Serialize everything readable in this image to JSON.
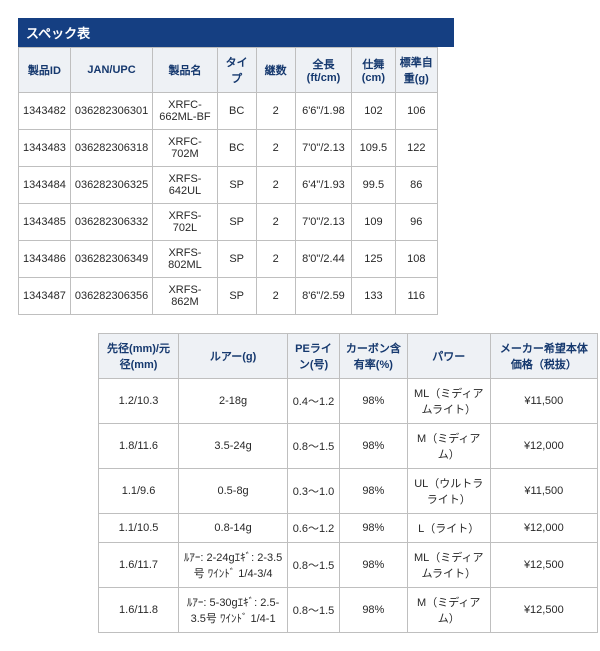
{
  "title": "スペック表",
  "table1": {
    "headers": [
      "製品ID",
      "JAN/UPC",
      "製品名",
      "タイプ",
      "継数",
      "全長(ft/cm)",
      "仕舞(cm)",
      "標準自重(g)"
    ],
    "rows": [
      [
        "1343482",
        "036282306301",
        "XRFC-662ML-BF",
        "BC",
        "2",
        "6'6\"/1.98",
        "102",
        "106"
      ],
      [
        "1343483",
        "036282306318",
        "XRFC-702M",
        "BC",
        "2",
        "7'0\"/2.13",
        "109.5",
        "122"
      ],
      [
        "1343484",
        "036282306325",
        "XRFS-642UL",
        "SP",
        "2",
        "6'4\"/1.93",
        "99.5",
        "86"
      ],
      [
        "1343485",
        "036282306332",
        "XRFS-702L",
        "SP",
        "2",
        "7'0\"/2.13",
        "109",
        "96"
      ],
      [
        "1343486",
        "036282306349",
        "XRFS-802ML",
        "SP",
        "2",
        "8'0\"/2.44",
        "125",
        "108"
      ],
      [
        "1343487",
        "036282306356",
        "XRFS-862M",
        "SP",
        "2",
        "8'6\"/2.59",
        "133",
        "116"
      ]
    ]
  },
  "table2": {
    "headers": [
      "先径(mm)/元径(mm)",
      "ルアー(g)",
      "PEライン(号)",
      "カーボン含有率(%)",
      "パワー",
      "メーカー希望本体価格（税抜）"
    ],
    "rows": [
      [
        "1.2/10.3",
        "2-18g",
        "0.4～1.2",
        "98%",
        "ML（ミディアムライト）",
        "¥11,500"
      ],
      [
        "1.8/11.6",
        "3.5-24g",
        "0.8～1.5",
        "98%",
        "M（ミディアム）",
        "¥12,000"
      ],
      [
        "1.1/9.6",
        "0.5-8g",
        "0.3～1.0",
        "98%",
        "UL（ウルトラライト）",
        "¥11,500"
      ],
      [
        "1.1/10.5",
        "0.8-14g",
        "0.6～1.2",
        "98%",
        "L（ライト）",
        "¥12,000"
      ],
      [
        "1.6/11.7",
        "ﾙｱｰ: 2-24gｴｷﾞ: 2-3.5号 ﾜｲﾝﾄﾞ 1/4-3/4",
        "0.8～1.5",
        "98%",
        "ML（ミディアムライト）",
        "¥12,500"
      ],
      [
        "1.6/11.8",
        "ﾙｱｰ: 5-30gｴｷﾞ: 2.5-3.5号 ﾜｲﾝﾄﾞ 1/4-1",
        "0.8～1.5",
        "98%",
        "M（ミディアム）",
        "¥12,500"
      ]
    ]
  }
}
